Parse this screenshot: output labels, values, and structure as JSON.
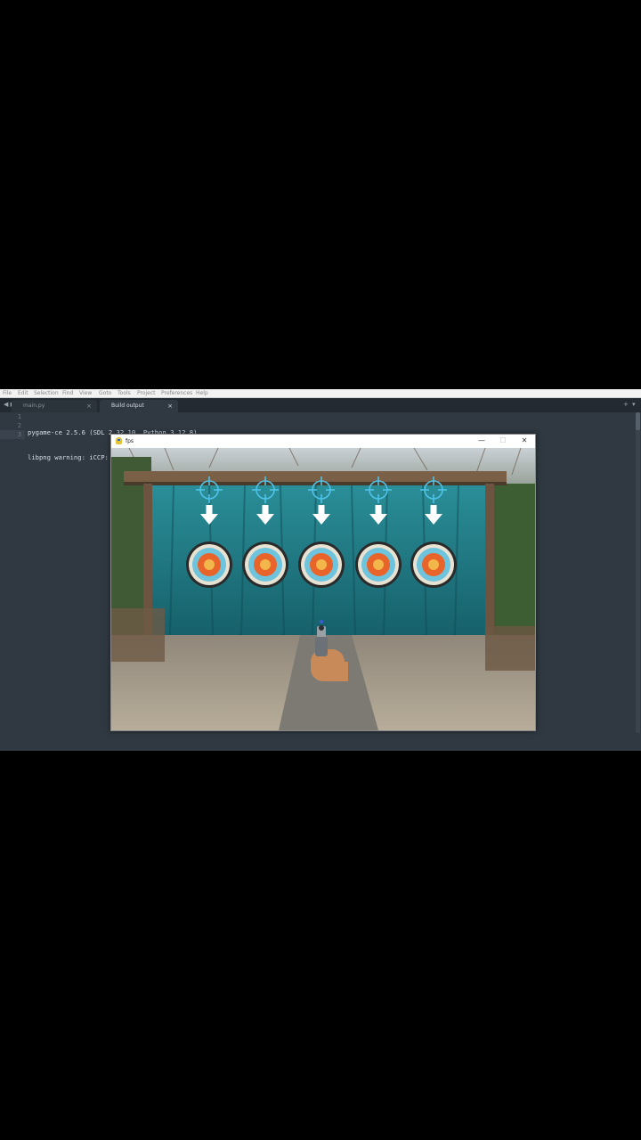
{
  "editor": {
    "menu": [
      "File",
      "Edit",
      "Selection",
      "Find",
      "View",
      "Goto",
      "Tools",
      "Project",
      "Preferences",
      "Help"
    ],
    "tabs": [
      {
        "label": "main.py",
        "active": false
      },
      {
        "label": "Build output",
        "active": true
      }
    ],
    "lines": [
      {
        "num": "1",
        "text": "pygame-ce 2.5.6 (SDL 2.32.10, Python 3.12.8)"
      },
      {
        "num": "2",
        "text": "libpng warning: iCCP: known incorrect sRGB profile"
      },
      {
        "num": "3",
        "text": ""
      }
    ],
    "nav_left": "◀ ▶",
    "tab_close": "×",
    "plus": "+",
    "dropdown": "▾"
  },
  "game_window": {
    "title": "fps",
    "controls": {
      "minimize": "—",
      "maximize": "☐",
      "close": "✕"
    },
    "targets_count": 5,
    "colors": {
      "curtain": "#1f7c86",
      "crosshair": "#4fc3e8",
      "target_orange": "#e8642a",
      "target_blue": "#6ec3dd"
    }
  }
}
